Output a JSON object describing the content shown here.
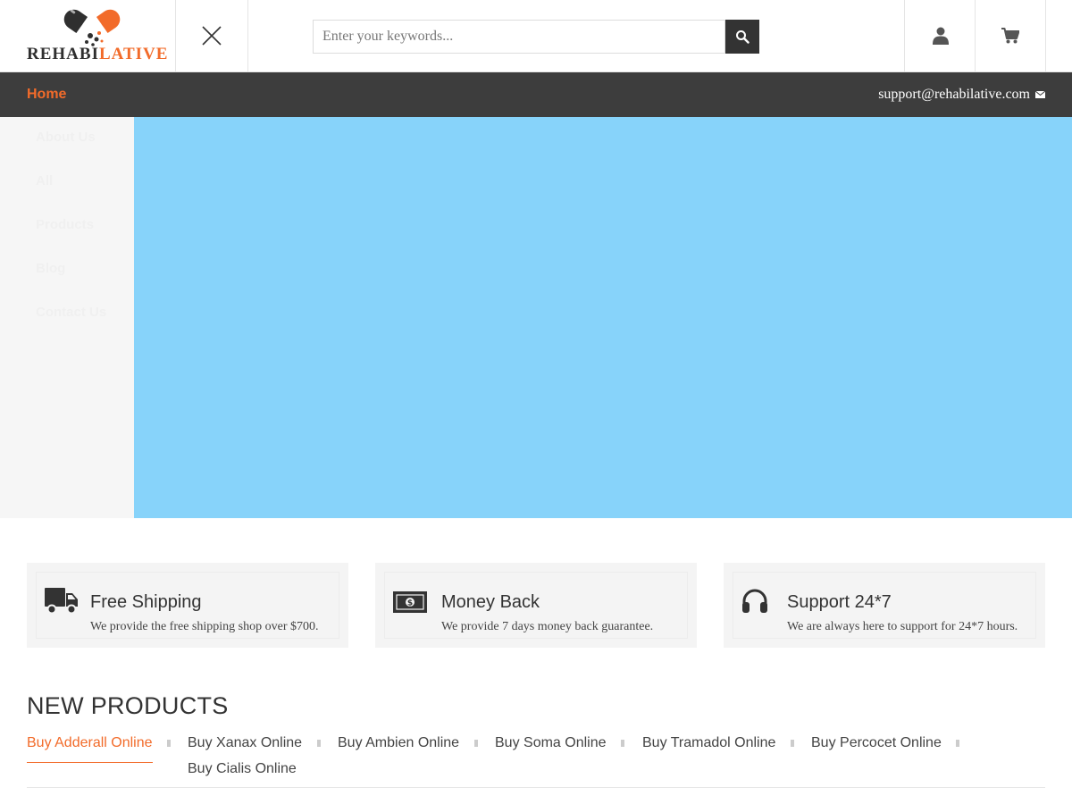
{
  "brand": {
    "name_dark": "REHABI",
    "name_accent": "LATIVE",
    "accent_color": "#f26b2a",
    "dark_color": "#2f2f2f"
  },
  "header": {
    "search_placeholder": "Enter your keywords...",
    "icons": [
      "close-icon",
      "search-icon",
      "user-icon",
      "cart-icon"
    ]
  },
  "navbar": {
    "home_label": "Home",
    "email": "support@rehabilative.com",
    "background": "#3d3d3d"
  },
  "side_menu": {
    "items": [
      {
        "label": "About Us"
      },
      {
        "label": "All"
      },
      {
        "label": "Products"
      },
      {
        "label": "Blog"
      },
      {
        "label": "Contact Us"
      }
    ]
  },
  "banner": {
    "background": "#87d3fa"
  },
  "features": [
    {
      "icon": "truck-icon",
      "title": "Free Shipping",
      "desc": "We provide the free shipping shop over $700."
    },
    {
      "icon": "money-icon",
      "title": "Money Back",
      "desc": "We provide 7 days money back guarantee."
    },
    {
      "icon": "headphones-icon",
      "title": "Support 24*7",
      "desc": "We are always here to support for 24*7 hours."
    }
  ],
  "new_products": {
    "title": "NEW PRODUCTS",
    "tabs": [
      {
        "label": "Buy Adderall Online",
        "active": true
      },
      {
        "label": "Buy Xanax Online"
      },
      {
        "label": "Buy Ambien Online"
      },
      {
        "label": "Buy Soma Online"
      },
      {
        "label": "Buy Tramadol Online"
      },
      {
        "label": "Buy Percocet Online"
      },
      {
        "label": "Buy Cialis Online"
      }
    ]
  }
}
